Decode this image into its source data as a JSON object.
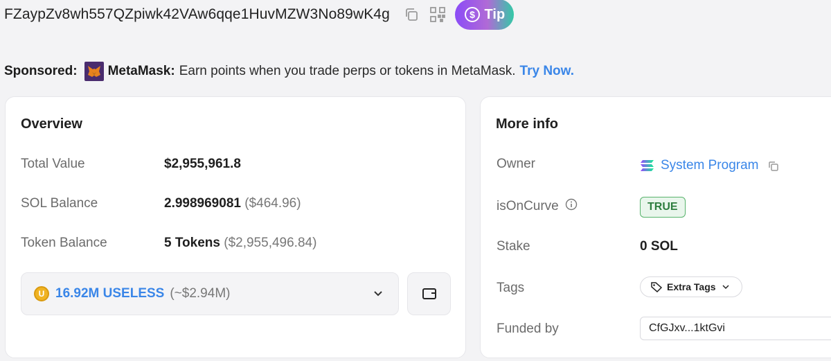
{
  "header": {
    "address": "FZaypZv8wh557QZpiwk42VAw6qqe1HuvMZW3No89wK4g",
    "tip_label": "Tip"
  },
  "sponsored": {
    "label": "Sponsored:",
    "brand": "MetaMask:",
    "text": "Earn points when you trade perps or tokens in MetaMask.",
    "link": "Try Now."
  },
  "overview": {
    "title": "Overview",
    "rows": [
      {
        "label": "Total Value",
        "value": "$2,955,961.8",
        "extra": ""
      },
      {
        "label": "SOL Balance",
        "value": "2.998969081",
        "extra": "($464.96)"
      },
      {
        "label": "Token Balance",
        "value": "5 Tokens",
        "extra": "($2,955,496.84)"
      }
    ],
    "token_select": {
      "amount": "16.92M USELESS",
      "usd": "(~$2.94M)"
    }
  },
  "more_info": {
    "title": "More info",
    "owner_label": "Owner",
    "owner_value": "System Program",
    "curve_label": "isOnCurve",
    "curve_value": "TRUE",
    "stake_label": "Stake",
    "stake_value": "0 SOL",
    "tags_label": "Tags",
    "tags_value": "Extra Tags",
    "funded_label": "Funded by",
    "funded_value": "CfGJxv...1ktGvi"
  },
  "colors": {
    "accent": "#3a86e8",
    "badge_green": "#57b36b"
  }
}
